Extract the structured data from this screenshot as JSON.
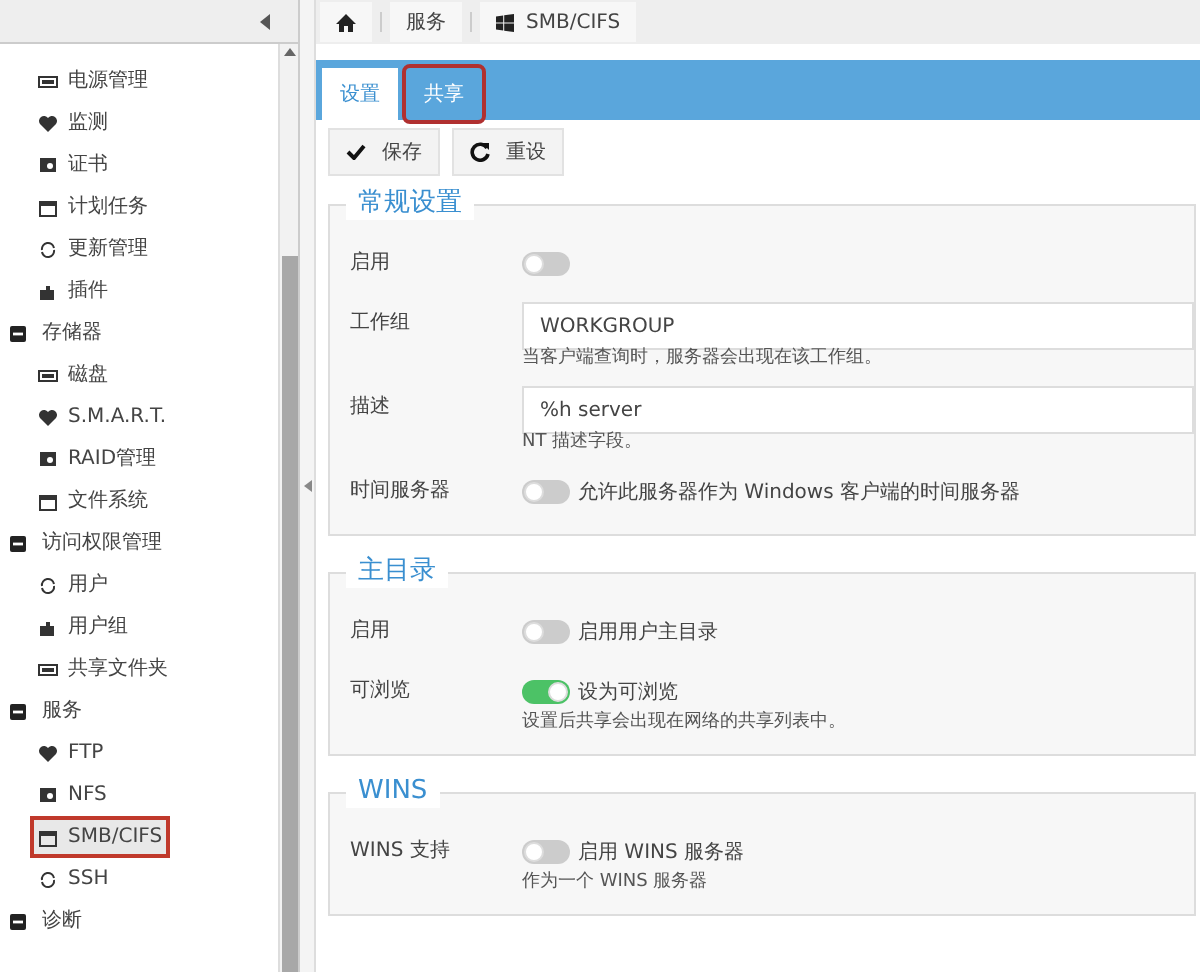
{
  "breadcrumb": [
    {
      "kind": "home"
    },
    {
      "kind": "text",
      "label": "服务"
    },
    {
      "kind": "windows",
      "label": "SMB/CIFS"
    }
  ],
  "nav": [
    {
      "children": [
        {
          "label": "电源管理",
          "selected": false
        },
        {
          "label": "监测",
          "selected": false
        },
        {
          "label": "证书",
          "selected": false
        },
        {
          "label": "计划任务",
          "selected": false
        },
        {
          "label": "更新管理",
          "selected": false
        },
        {
          "label": "插件",
          "selected": false
        }
      ]
    },
    {
      "label": "存储器",
      "expanded": true,
      "children": [
        {
          "label": "磁盘",
          "selected": false
        },
        {
          "label": "S.M.A.R.T.",
          "selected": false
        },
        {
          "label": "RAID管理",
          "selected": false
        },
        {
          "label": "文件系统",
          "selected": false
        }
      ]
    },
    {
      "label": "访问权限管理",
      "expanded": true,
      "children": [
        {
          "label": "用户",
          "selected": false
        },
        {
          "label": "用户组",
          "selected": false
        },
        {
          "label": "共享文件夹",
          "selected": false
        }
      ]
    },
    {
      "label": "服务",
      "expanded": true,
      "children": [
        {
          "label": "FTP",
          "selected": false
        },
        {
          "label": "NFS",
          "selected": false
        },
        {
          "label": "SMB/CIFS",
          "selected": true
        },
        {
          "label": "SSH",
          "selected": false
        }
      ]
    },
    {
      "label": "诊断",
      "expanded": true
    }
  ],
  "tabs": [
    {
      "label": "设置",
      "selected": true,
      "highlighted": false
    },
    {
      "label": "共享",
      "selected": false,
      "highlighted": true
    }
  ],
  "toolbar": [
    {
      "kind": "check",
      "label": "保存"
    },
    {
      "kind": "reload",
      "label": "重设"
    }
  ],
  "sections": [
    {
      "title": "常规设置",
      "rows": [
        {
          "kind": "toggle",
          "label": "启用",
          "on": false
        },
        {
          "kind": "text",
          "label": "工作组",
          "value": "WORKGROUP",
          "hint": "当客户端查询时，服务器会出现在该工作组。"
        },
        {
          "kind": "text",
          "label": "描述",
          "value": "%h server",
          "hint": "NT 描述字段。"
        },
        {
          "kind": "toggle",
          "label": "时间服务器",
          "on": false,
          "text": "允许此服务器作为 Windows 客户端的时间服务器"
        }
      ]
    },
    {
      "title": "主目录",
      "rows": [
        {
          "kind": "toggle",
          "label": "启用",
          "on": false,
          "text": "启用用户主目录"
        },
        {
          "kind": "toggle",
          "label": "可浏览",
          "on": true,
          "text": "设为可浏览",
          "hint": "设置后共享会出现在网络的共享列表中。"
        }
      ]
    },
    {
      "title": "WINS",
      "rows": [
        {
          "kind": "toggle",
          "label": "WINS 支持",
          "on": false,
          "text": "启用 WINS 服务器",
          "hint": "作为一个 WINS 服务器"
        }
      ]
    }
  ]
}
